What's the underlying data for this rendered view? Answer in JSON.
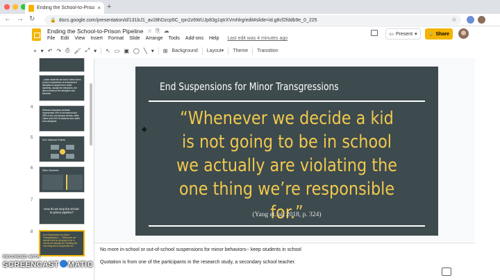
{
  "browser": {
    "tab_title": "Ending the School-to-Prison P",
    "tab_close": "×",
    "new_tab": "+",
    "url": "docs.google.com/presentation/d/131bJ1_av28hDzcp5C_rpn2z6WUJp83g1qtrXVmhlrg/edit#slide=id.g8cf2fddb9e_0_225",
    "nav": {
      "back": "←",
      "forward": "→",
      "reload": "↻",
      "lock": "🔒",
      "bookmark": "☆"
    },
    "colors": {
      "close": "#ff5f57",
      "minimize": "#febc2e",
      "zoom": "#28c840"
    }
  },
  "app": {
    "title": "Ending the  School-to-Prison Pipeline",
    "title_icons": [
      "☆",
      "⎘",
      "☁"
    ],
    "menu": [
      "File",
      "Edit",
      "View",
      "Insert",
      "Format",
      "Slide",
      "Arrange",
      "Tools",
      "Add-ons",
      "Help"
    ],
    "last_edit": "Last edit was 4 minutes ago",
    "present_label": "Present",
    "present_icon": "▭",
    "present_caret": "▾",
    "share_label": "Share",
    "share_icon": "🔒",
    "accent": "#f4b400"
  },
  "toolbar": {
    "icons": [
      "+",
      "▾",
      "↶",
      "↷",
      "⎙",
      "🖌",
      "⤢",
      "▾",
      "↖",
      "▭",
      "▣",
      "◯",
      "╲",
      "▾",
      "⊞"
    ],
    "background": "Background",
    "layout": "Layout",
    "layout_caret": "▾",
    "theme": "Theme",
    "transition": "Transition"
  },
  "filmstrip": [
    {
      "num": "",
      "text": "",
      "selected": false
    },
    {
      "num": "",
      "text": "...when students are lost to these forms (Lick) to experience re-involvement disruptions caused from suffer students, usually the behaviors, the direct influence the discipline and behavior.",
      "selected": false
    },
    {
      "num": "4",
      "text": "Whereas American students represented 18% of enrollment and 35% of are out-campus arrests, while Latinx and 44% of students who suffer from discipline.",
      "selected": false
    },
    {
      "num": "5",
      "text": "Zero Tolerance Policies",
      "selected": false
    },
    {
      "num": "6",
      "text": "Other Outcomes",
      "selected": false
    },
    {
      "num": "7",
      "text": "How do we stop the school-to-prison pipeline?",
      "selected": false
    },
    {
      "num": "8",
      "text": "End Suspensions for Minor Transgressions — \"Whenever we decide a kid is not going to be in school we actually are violating the one thing we're responsible for.\"",
      "selected": true
    }
  ],
  "slide": {
    "heading": "End Suspensions for Minor Transgressions",
    "quote": "“Whenever we decide a kid is not going to be in school we actually are violating the one thing we’re responsible for.”",
    "citation": "(Yang et. al, 2018, p. 324)",
    "bg_color": "#3d4a4e",
    "quote_color": "#f0c94e"
  },
  "notes": {
    "line1": "No more in-school or out-of-school suspensions for minor behaviors-- keep students in school",
    "line2": "Quotation is from one of the participants in the research study, a secondary school teacher."
  },
  "watermark": {
    "line1": "RECORDED WITH",
    "line2a": "SCREENCAST",
    "line2b": "MATIC"
  }
}
